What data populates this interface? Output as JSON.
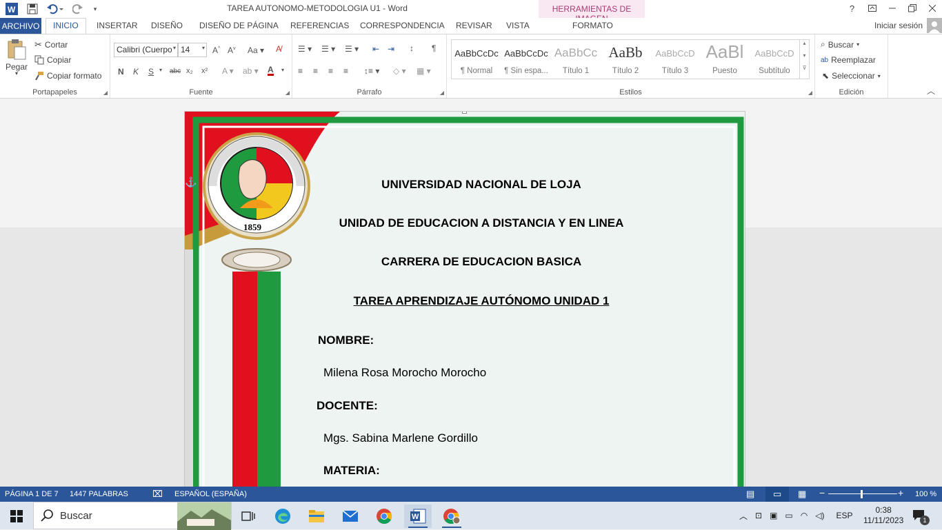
{
  "window": {
    "title": "TAREA AUTONOMO-METODOLOGIA U1 - Word",
    "help": "?",
    "contextual_header": "HERRAMIENTAS DE IMAGEN",
    "contextual_tab": "FORMATO"
  },
  "tabs": [
    "ARCHIVO",
    "INICIO",
    "INSERTAR",
    "DISEÑO",
    "DISEÑO DE PÁGINA",
    "REFERENCIAS",
    "CORRESPONDENCIA",
    "REVISAR",
    "VISTA"
  ],
  "signin": "Iniciar sesión",
  "clipboard": {
    "paste": "Pegar",
    "cut": "Cortar",
    "copy": "Copiar",
    "format_painter": "Copiar formato",
    "label": "Portapapeles"
  },
  "font": {
    "name": "Calibri (Cuerpo",
    "size": "14",
    "label": "Fuente",
    "bold": "N",
    "italic": "K",
    "underline": "S",
    "strike": "abc",
    "sub": "x₂",
    "sup": "x²"
  },
  "paragraph": {
    "label": "Párrafo"
  },
  "styles": {
    "label": "Estilos",
    "items": [
      {
        "sample": "AaBbCcDc",
        "name": "¶ Normal"
      },
      {
        "sample": "AaBbCcDc",
        "name": "¶ Sin espa..."
      },
      {
        "sample": "AaBbCc",
        "name": "Título 1"
      },
      {
        "sample": "AaBb",
        "name": "Título 2"
      },
      {
        "sample": "AaBbCcD",
        "name": "Título 3"
      },
      {
        "sample": "AaBl",
        "name": "Puesto"
      },
      {
        "sample": "AaBbCcD",
        "name": "Subtítulo"
      }
    ]
  },
  "editing": {
    "find": "Buscar",
    "replace": "Reemplazar",
    "select": "Seleccionar",
    "label": "Edición"
  },
  "document": {
    "seal_year": "1859",
    "line1": "UNIVERSIDAD NACIONAL DE LOJA",
    "line2": "UNIDAD DE EDUCACION A DISTANCIA Y EN LINEA",
    "line3": "CARRERA DE EDUCACION BASICA",
    "line4": "TAREA APRENDIZAJE AUTÓNOMO UNIDAD 1",
    "nombre_label": "NOMBRE:",
    "nombre_value": "Milena Rosa Morocho Morocho",
    "docente_label": "DOCENTE:",
    "docente_value": "Mgs. Sabina Marlene Gordillo",
    "materia_label": "MATERIA:"
  },
  "status": {
    "page": "PÁGINA 1 DE 7",
    "words": "1447 PALABRAS",
    "language": "ESPAÑOL (ESPAÑA)",
    "zoom": "100 %"
  },
  "taskbar": {
    "search_placeholder": "Buscar",
    "lang": "ESP",
    "time": "0:38",
    "date": "11/11/2023",
    "notif_count": "1"
  },
  "colors": {
    "word_blue": "#2b579a",
    "contextual_pink": "#a83b73",
    "border_green": "#1f9a3f",
    "band_red": "#e0101f"
  }
}
